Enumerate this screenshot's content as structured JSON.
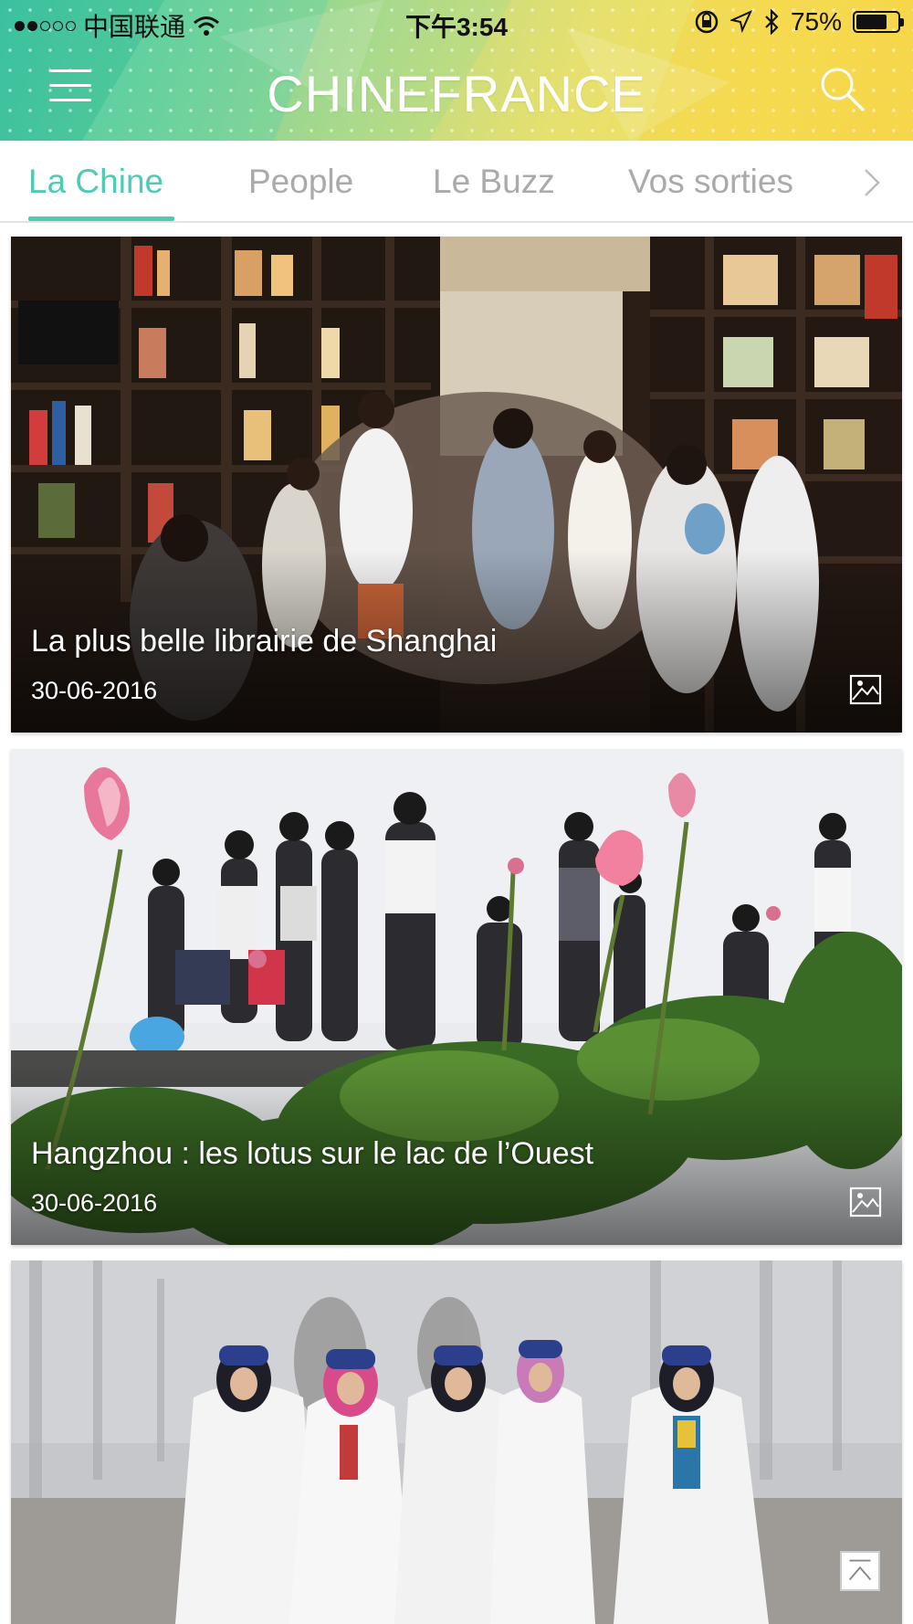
{
  "statusbar": {
    "carrier": "中国联通",
    "time": "下午3:54",
    "battery": "75%",
    "battery_level": 0.75
  },
  "header": {
    "brand": "CHINEFRANCE",
    "menu_icon": "hamburger-menu-icon",
    "search_icon": "search-icon"
  },
  "tabs": [
    {
      "label": "La Chine",
      "active": true
    },
    {
      "label": "People"
    },
    {
      "label": "Le Buzz"
    },
    {
      "label": "Vos sorties"
    }
  ],
  "articles": [
    {
      "title": "La plus belle librairie de Shanghai",
      "date": "30-06-2016",
      "badge_icon": "gallery-icon"
    },
    {
      "title": "Hangzhou : les lotus sur le lac de l’Ouest",
      "date": "30-06-2016",
      "badge_icon": "gallery-icon"
    },
    {
      "title": "",
      "date": ""
    }
  ],
  "colors": {
    "accent": "#4fcbb4",
    "tab_inactive": "#aaaaaa"
  }
}
